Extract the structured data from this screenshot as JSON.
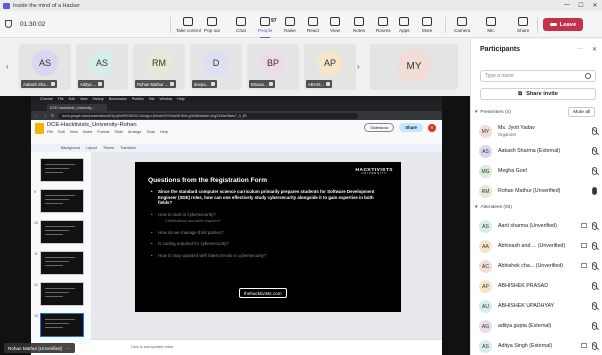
{
  "window": {
    "title": "Inside the mind of a Hacker"
  },
  "meeting": {
    "timer": "01:30:02",
    "toolbar": [
      {
        "key": "take_control",
        "label": "Take control"
      },
      {
        "key": "pop_out",
        "label": "Pop out"
      },
      {
        "key": "chat",
        "label": "Chat"
      },
      {
        "key": "people",
        "label": "People",
        "count": "97"
      },
      {
        "key": "raise",
        "label": "Raise"
      },
      {
        "key": "react",
        "label": "React"
      },
      {
        "key": "view",
        "label": "View"
      },
      {
        "key": "notes",
        "label": "Notes"
      },
      {
        "key": "rooms",
        "label": "Rooms"
      },
      {
        "key": "apps",
        "label": "Apps"
      },
      {
        "key": "more",
        "label": "More"
      },
      {
        "key": "camera",
        "label": "Camera"
      },
      {
        "key": "mic",
        "label": "Mic"
      },
      {
        "key": "share",
        "label": "Share"
      }
    ],
    "leave_label": "Leave"
  },
  "strip": {
    "tiles": [
      {
        "initials": "AS",
        "name": "Aakash Sha...",
        "color": "#d8d6f0"
      },
      {
        "initials": "AS",
        "name": "Aditya ...",
        "color": "#d7ecec"
      },
      {
        "initials": "RM",
        "name": "Rohan Mathur ...",
        "color": "#e6e9d6"
      },
      {
        "initials": "D",
        "name": "deepa...",
        "color": "#dde0f3"
      },
      {
        "initials": "BP",
        "name": "Bhawa...",
        "color": "#ecdbe9"
      },
      {
        "initials": "AP",
        "name": "ABHIS...",
        "color": "#f5e6c9"
      },
      {
        "initials": "MY",
        "name": "",
        "color": "#f2dcd6"
      }
    ]
  },
  "share": {
    "mac_menu": [
      "Chrome",
      "File",
      "Edit",
      "View",
      "History",
      "Bookmarks",
      "Profiles",
      "Tab",
      "Window",
      "Help"
    ],
    "browser_tab": "DCE-Hacktivists_University-...",
    "url": "docs.google.com/presentation/d/1pxyDsRVE8UVU-GxwgLnJb4nzkVtYW4a0dHWrx-g0436e#slide=id.g2436e49aee7_0_83",
    "doc_title": "DCE-Hacktivists_University-Rohan",
    "doc_menu": [
      "File",
      "Edit",
      "View",
      "Insert",
      "Format",
      "Slide",
      "Arrange",
      "Tools",
      "Help"
    ],
    "slideshow_label": "Slideshow",
    "share_label": "Share",
    "user_initial": "R",
    "tools": [
      "Background",
      "Layout",
      "Theme",
      "Transition"
    ],
    "thumb_numbers": [
      "",
      "9",
      "10",
      "11",
      "12",
      "13"
    ],
    "slide": {
      "title": "Questions from the Registration Form",
      "brand": "HACKTIVISTS",
      "brand_sub": "UNIVERSITY",
      "bullets": [
        {
          "text": "Since the standard computer science curriculum primarily prepares students for Software Development Engineer (SDE) roles, how can one effectively study cybersecurity alongside it to gain expertise in both fields?",
          "style": "main"
        },
        {
          "text": "How to start in cybersecurity?",
          "style": "dim"
        },
        {
          "text": "Certifications and skills required?",
          "style": "sub"
        },
        {
          "text": "How do we manage third parties?",
          "style": "dim"
        },
        {
          "text": "Is coding required for cybersecurity?",
          "style": "dim"
        },
        {
          "text": "How to stay updated with latest trends in cybersecurity?",
          "style": "dim"
        }
      ],
      "site": "thehacktivists.com"
    },
    "notes_placeholder": "Click to add speaker notes",
    "presenter": "Rohan Mathur (Unverified)"
  },
  "panel": {
    "title": "Participants",
    "search_placeholder": "Type a name",
    "invite_label": "Share invite",
    "presenters_label": "Presenters (4)",
    "mute_all": "Mute all",
    "presenters": [
      {
        "initials": "MY",
        "name": "Ms. Jyoti Yadav",
        "sub": "Organizer",
        "color": "#f2dcd6",
        "mic": "off"
      },
      {
        "initials": "AS",
        "name": "Aakash Sharma (External)",
        "sub": "",
        "color": "#d8d6f0",
        "mic": "off"
      },
      {
        "initials": "MG",
        "name": "Megha Goel",
        "sub": "",
        "color": "#d9ecd9",
        "mic": "off"
      },
      {
        "initials": "RM",
        "name": "Rohan Mathur (Unverified)",
        "sub": "",
        "color": "#e6e9d6",
        "mic": "on"
      }
    ],
    "attendees_label": "Attendees (93)",
    "attendees": [
      {
        "initials": "AS",
        "name": "Aarti sharma (Unverified)",
        "color": "#d7ecec",
        "screen": true
      },
      {
        "initials": "AA",
        "name": "Abhinash and ... (Unverified)",
        "color": "#f5e6c9",
        "screen": true
      },
      {
        "initials": "AC",
        "name": "Abhishek cha... (Unverified)",
        "color": "#f2dcd6",
        "screen": true
      },
      {
        "initials": "AP",
        "name": "ABHISHEK PRASAD",
        "color": "#f5e6c9",
        "screen": false
      },
      {
        "initials": "AU",
        "name": "ABHISHEK UPADHYAY",
        "color": "#d7ecec",
        "screen": false
      },
      {
        "initials": "AG",
        "name": "aditya gupta (External)",
        "color": "#ecdbe9",
        "screen": false
      },
      {
        "initials": "AS",
        "name": "Aditya Singh (External)",
        "color": "#d7ecec",
        "screen": true
      }
    ]
  }
}
